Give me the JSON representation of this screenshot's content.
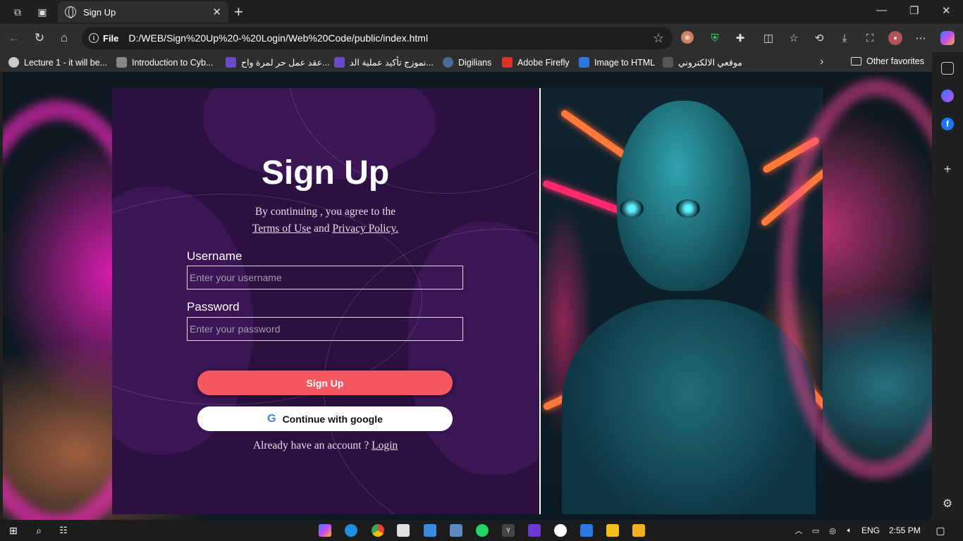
{
  "browser": {
    "tab_title": "Sign Up",
    "close_tab": "✕",
    "new_tab": "+",
    "address_scheme": "File",
    "address_url": "D:/WEB/Sign%20Up%20-%20Login/Web%20Code/public/index.html",
    "win_min": "—",
    "win_max": "❐",
    "win_close": "✕"
  },
  "bookmarks": {
    "items": [
      {
        "label": "Lecture 1 - it will be..."
      },
      {
        "label": "Introduction to Cyb..."
      },
      {
        "label": "عقد عمل حر لمرة واح..."
      },
      {
        "label": "نموزج تأكيد عملية الد..."
      },
      {
        "label": "Digilians"
      },
      {
        "label": "Adobe Firefly"
      },
      {
        "label": "Image to HTML"
      },
      {
        "label": "موقعي الالكتروني"
      }
    ],
    "other": "Other favorites"
  },
  "page": {
    "title": "Sign Up",
    "agree_text": "By continuing , you agree to the",
    "terms_link": "Terms of Use",
    "and_text": "and",
    "privacy_link": "Privacy Policy.",
    "username_label": "Username",
    "username_placeholder": "Enter your username",
    "password_label": "Password",
    "password_placeholder": "Enter your password",
    "signup_button": "Sign Up",
    "google_button": "Continue with google",
    "already_text": "Already have an account ?",
    "login_link": "Login"
  },
  "taskbar": {
    "language": "ENG",
    "time": "2:55 PM"
  },
  "colors": {
    "card_bg": "#2b1040",
    "signup_button": "#f5595f",
    "google_button": "#ffffff"
  }
}
